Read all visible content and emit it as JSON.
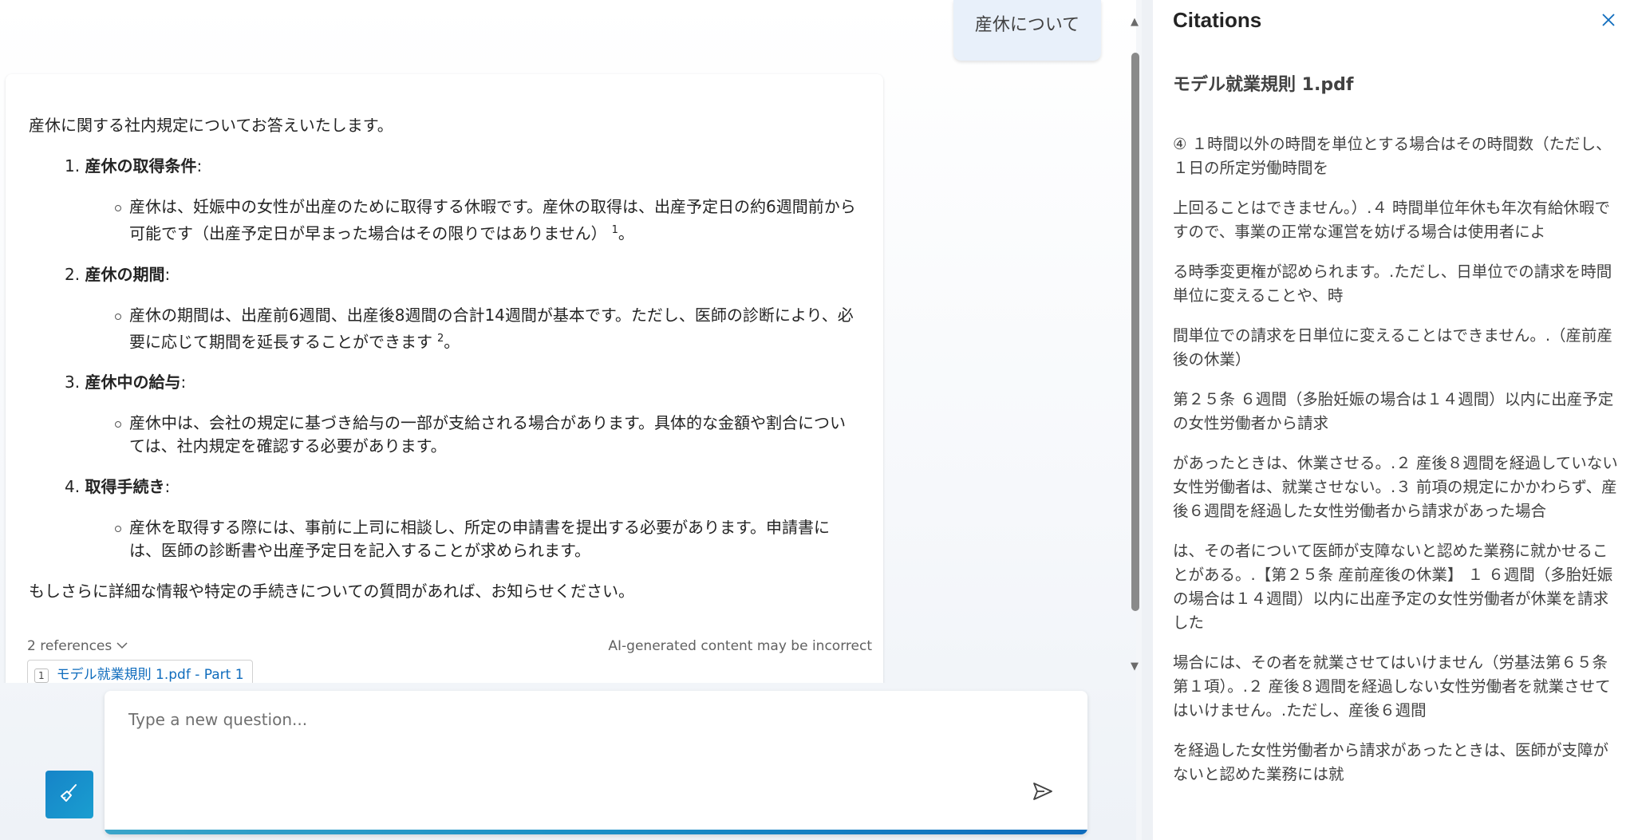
{
  "chat": {
    "user_message": "産休について",
    "answer": {
      "intro": "産休に関する社内規定についてお答えいたします。",
      "sections": [
        {
          "num": "1.",
          "title": "産休の取得条件",
          "body": "産休は、妊娠中の女性が出産のために取得する休暇です。産休の取得は、出産予定日の約6週間前から可能です（出産予定日が早まった場合はその限りではありません）",
          "ref": "1",
          "end": "。"
        },
        {
          "num": "2.",
          "title": "産休の期間",
          "body": "産休の期間は、出産前6週間、出産後8週間の合計14週間が基本です。ただし、医師の診断により、必要に応じて期間を延長することができます",
          "ref": "2",
          "end": "。"
        },
        {
          "num": "3.",
          "title": "産休中の給与",
          "body": "産休中は、会社の規定に基づき給与の一部が支給される場合があります。具体的な金額や割合については、社内規定を確認する必要があります。",
          "ref": "",
          "end": ""
        },
        {
          "num": "4.",
          "title": "取得手続き",
          "body": "産休を取得する際には、事前に上司に相談し、所定の申請書を提出する必要があります。申請書には、医師の診断書や出産予定日を記入することが求められます。",
          "ref": "",
          "end": ""
        }
      ],
      "outro": "もしさらに詳細な情報や特定の手続きについての質問があれば、お知らせください。",
      "references_label": "2 references",
      "disclaimer": "AI-generated content may be incorrect",
      "reference_chip": {
        "num": "1",
        "label": "モデル就業規則 1.pdf - Part 1"
      }
    }
  },
  "composer": {
    "placeholder": "Type a new question...",
    "send_icon": "send-icon",
    "clear_icon": "broom-icon"
  },
  "citations": {
    "title": "Citations",
    "file_name": "モデル就業規則 1.pdf",
    "paragraphs": [
      "④ １時間以外の時間を単位とする場合はその時間数（ただし、１日の所定労働時間を",
      "上回ることはできません。）.４ 時間単位年休も年次有給休暇ですので、事業の正常な運営を妨げる場合は使用者によ",
      "る時季変更権が認められます。.ただし、日単位での請求を時間単位に変えることや、時",
      "間単位での請求を日単位に変えることはできません。.（産前産後の休業）",
      "第２５条 ６週間（多胎妊娠の場合は１４週間）以内に出産予定の女性労働者から請求",
      "があったときは、休業させる。.２ 産後８週間を経過していない女性労働者は、就業させない。.３ 前項の規定にかかわらず、産後６週間を経過した女性労働者から請求があった場合",
      "は、その者について医師が支障ないと認めた業務に就かせることがある。.【第２５条 産前産後の休業】 １ ６週間（多胎妊娠の場合は１４週間）以内に出産予定の女性労働者が休業を請求した",
      "場合には、その者を就業させてはいけません（労基法第６５条第１項）。.２ 産後８週間を経過しない女性労働者を就業させてはいけません。.ただし、産後６週間",
      "を経過した女性労働者から請求があったときは、医師が支障がないと認めた業務には就"
    ]
  },
  "colors": {
    "accent": "#0f6cbd",
    "user_bubble": "#e8f0fa",
    "clear_button": "#1684c8"
  }
}
